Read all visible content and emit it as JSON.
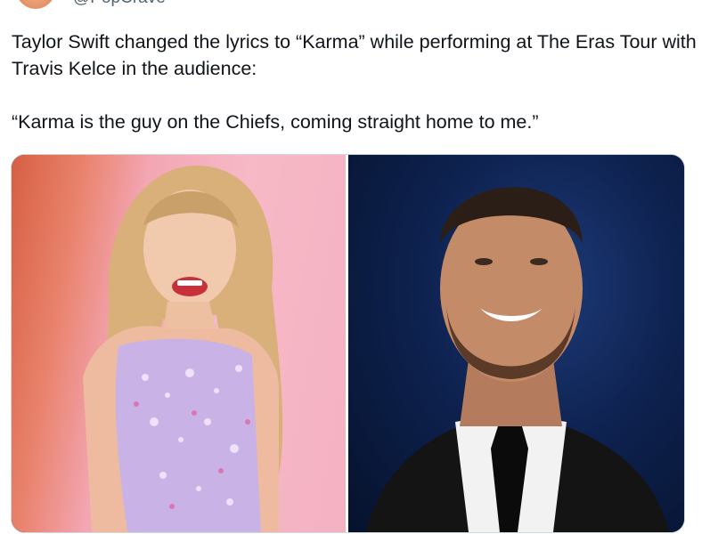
{
  "author": {
    "handle": "@PopCrave"
  },
  "tweet": {
    "line1": "Taylor Swift changed the lyrics to “Karma” while performing at The Eras Tour with Travis Kelce in the audience:",
    "quote": "“Karma is the guy on the Chiefs, coming straight home to me.”"
  },
  "colors": {
    "text": "#0f1419",
    "secondary": "#536471",
    "border": "#cfd9de"
  }
}
